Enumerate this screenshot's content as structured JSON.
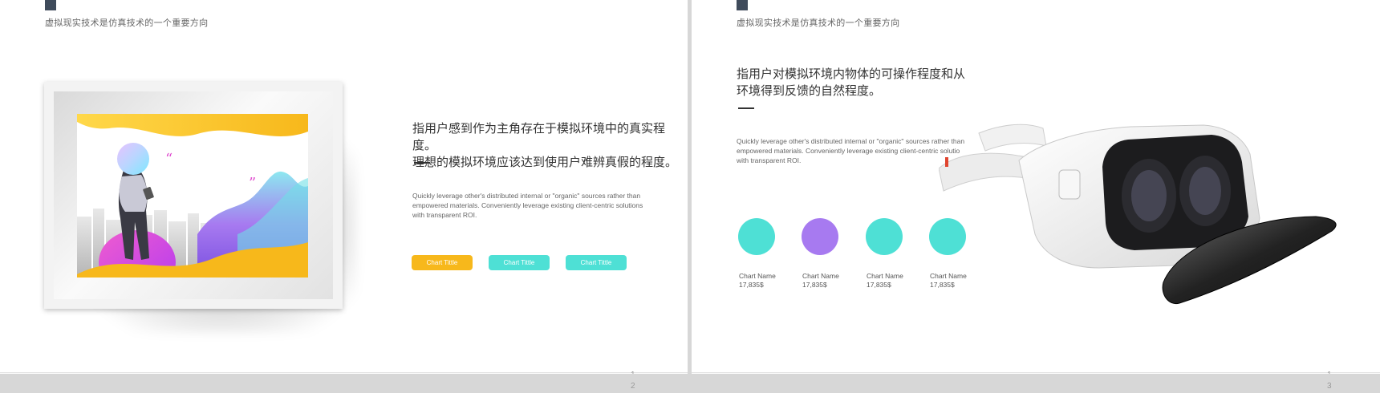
{
  "colors": {
    "accent_yellow": "#f7b81b",
    "accent_teal": "#4ee0d5",
    "accent_purple": "#a77af0",
    "tab_dark": "#3f4b5b"
  },
  "slide1": {
    "subtitle": "虚拟现实技术是仿真技术的一个重要方向",
    "heading_line1": "指用户感到作为主角存在于模拟环境中的真实程度。",
    "heading_line2": "理想的模拟环境应该达到使用户难辨真假的程度。",
    "body_line1": "Quickly leverage other's distributed internal or \"organic\" sources rather than",
    "body_line2": "empowered materials. Conveniently leverage existing client-centric solutions",
    "body_line3": "with transparent ROI.",
    "buttons": [
      "Chart Tittle",
      "Chart Tittle",
      "Chart Tittle"
    ],
    "page_num_top": "1",
    "page_num_bottom": "2"
  },
  "slide2": {
    "subtitle": "虚拟现实技术是仿真技术的一个重要方向",
    "heading_line1": "指用户对模拟环境内物体的可操作程度和从",
    "heading_line2": "环境得到反馈的自然程度。",
    "body_line1": "Quickly leverage other's distributed internal or \"organic\" sources rather than",
    "body_line2": "empowered materials. Conveniently leverage existing client-centric solutio",
    "body_line3": "with transparent ROI.",
    "charts": [
      {
        "name": "Chart Name",
        "value": "17,835$",
        "color": "#4ee0d5"
      },
      {
        "name": "Chart Name",
        "value": "17,835$",
        "color": "#a77af0"
      },
      {
        "name": "Chart Name",
        "value": "17,835$",
        "color": "#4ee0d5"
      },
      {
        "name": "Chart Name",
        "value": "17,835$",
        "color": "#4ee0d5"
      }
    ],
    "page_num_top": "1",
    "page_num_bottom": "3"
  }
}
